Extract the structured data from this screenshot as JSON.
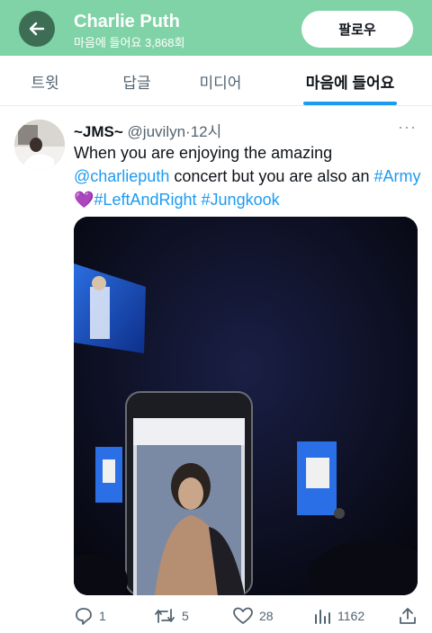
{
  "header": {
    "title": "Charlie Puth",
    "subtitle": "마음에 들어요 3,868회",
    "follow_label": "팔로우",
    "accent": "#7fd3a6"
  },
  "tabs": [
    {
      "label": "트윗",
      "active": false
    },
    {
      "label": "답글",
      "active": false
    },
    {
      "label": "미디어",
      "active": false
    },
    {
      "label": "마음에 들어요",
      "active": true
    }
  ],
  "tweet": {
    "author_name": "~JMS~",
    "handle": "@juvilyn",
    "separator": "·",
    "time": "12시",
    "more": "···",
    "text_part1": "When you are enjoying the amazing ",
    "mention": "@charlieputh",
    "text_part2": " concert but you are also an ",
    "hashtag1": "#Army",
    "emoji": "💜",
    "hashtag2": "#LeftAndRight",
    "hashtag3": "#Jungkook",
    "link_color": "#1d9bf0"
  },
  "actions": {
    "reply_count": "1",
    "retweet_count": "5",
    "like_count": "28",
    "views_count": "1162"
  }
}
